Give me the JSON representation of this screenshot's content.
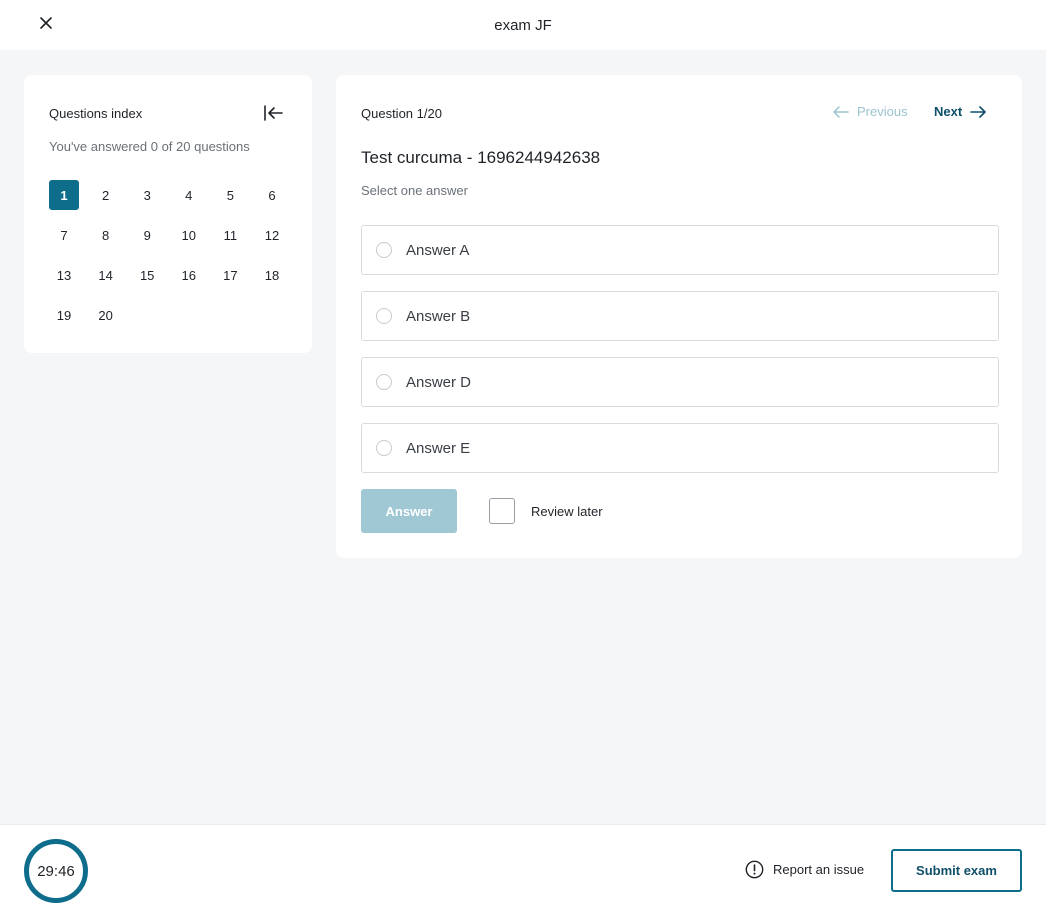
{
  "header": {
    "title": "exam JF",
    "close_icon": "close-icon"
  },
  "index": {
    "title": "Questions index",
    "collapse_icon": "collapse-left-icon",
    "summary": "You've answered 0 of 20 questions",
    "numbers": [
      "1",
      "2",
      "3",
      "4",
      "5",
      "6",
      "7",
      "8",
      "9",
      "10",
      "11",
      "12",
      "13",
      "14",
      "15",
      "16",
      "17",
      "18",
      "19",
      "20"
    ],
    "active": "1"
  },
  "question": {
    "counter": "Question 1/20",
    "previous_label": "Previous",
    "next_label": "Next",
    "title": "Test curcuma - 1696244942638",
    "instruction": "Select one answer",
    "answers": [
      "Answer A",
      "Answer B",
      "Answer D",
      "Answer E"
    ],
    "answer_button": "Answer",
    "review_label": "Review later"
  },
  "footer": {
    "timer": "29:46",
    "report_label": "Report an issue",
    "submit_label": "Submit exam"
  },
  "colors": {
    "accent": "#0e6d8a",
    "accent_dark": "#0f4f6a",
    "disabled": "#9fc8d4"
  }
}
